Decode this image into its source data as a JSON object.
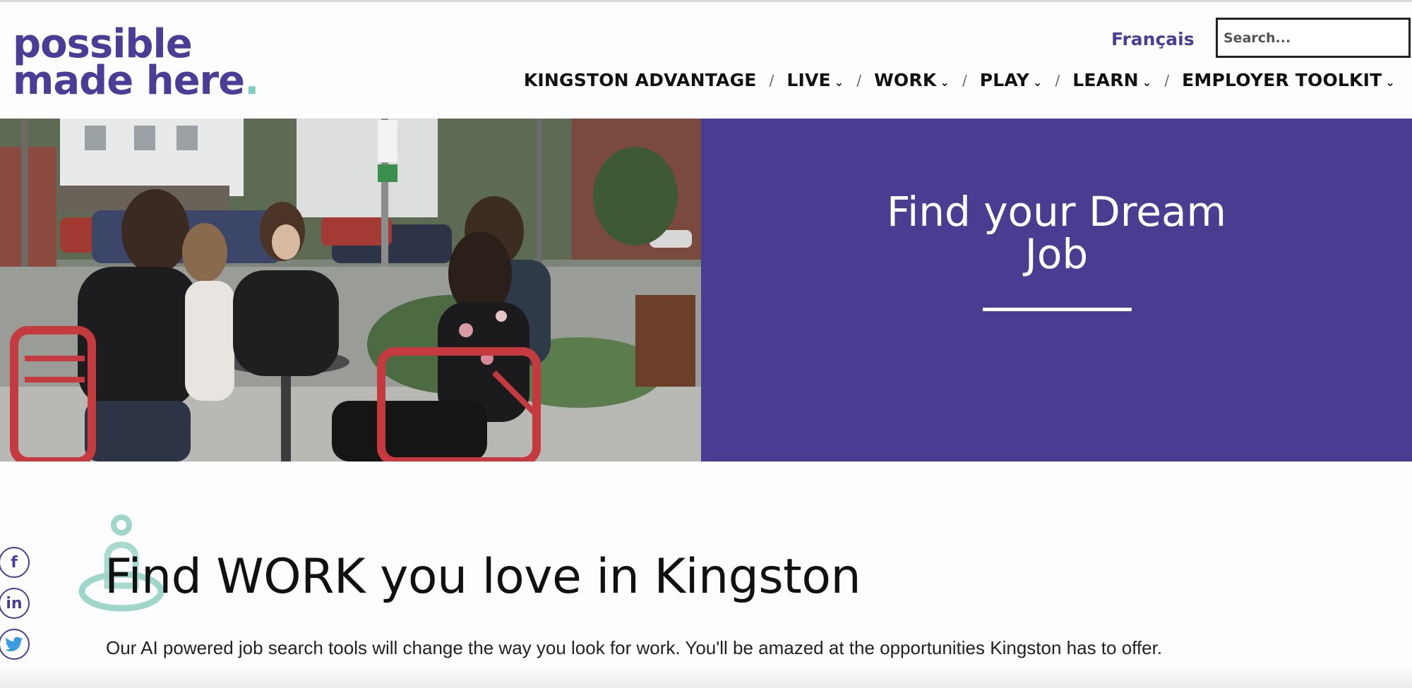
{
  "header": {
    "logo_line1": "possible",
    "logo_line2": "made here",
    "logo_dot": ".",
    "language_link": "Français",
    "search_placeholder": "Search..."
  },
  "nav": {
    "items": [
      {
        "label": "KINGSTON ADVANTAGE",
        "has_dropdown": false
      },
      {
        "label": "LIVE",
        "has_dropdown": true
      },
      {
        "label": "WORK",
        "has_dropdown": true
      },
      {
        "label": "PLAY",
        "has_dropdown": true
      },
      {
        "label": "LEARN",
        "has_dropdown": true
      },
      {
        "label": "EMPLOYER TOOLKIT",
        "has_dropdown": true
      }
    ],
    "separator": "/",
    "dropdown_glyph": "⌄"
  },
  "hero": {
    "title_line1": "Find your Dream",
    "title_line2": "Job",
    "panel_color": "#4a3d91"
  },
  "content": {
    "title": "Find WORK you love in Kingston",
    "text": "Our AI powered job search tools will change the way you look for work. You'll be amazed at the opportunities Kingston has to offer.",
    "icon": "person-location-pin-icon"
  },
  "social": {
    "items": [
      {
        "icon": "facebook-icon",
        "glyph": "f"
      },
      {
        "icon": "linkedin-icon",
        "glyph": "in"
      },
      {
        "icon": "twitter-icon",
        "glyph": ""
      }
    ]
  },
  "colors": {
    "brand_purple": "#4a3d97",
    "accent_teal": "#7fcfbf",
    "text_dark": "#111111"
  }
}
